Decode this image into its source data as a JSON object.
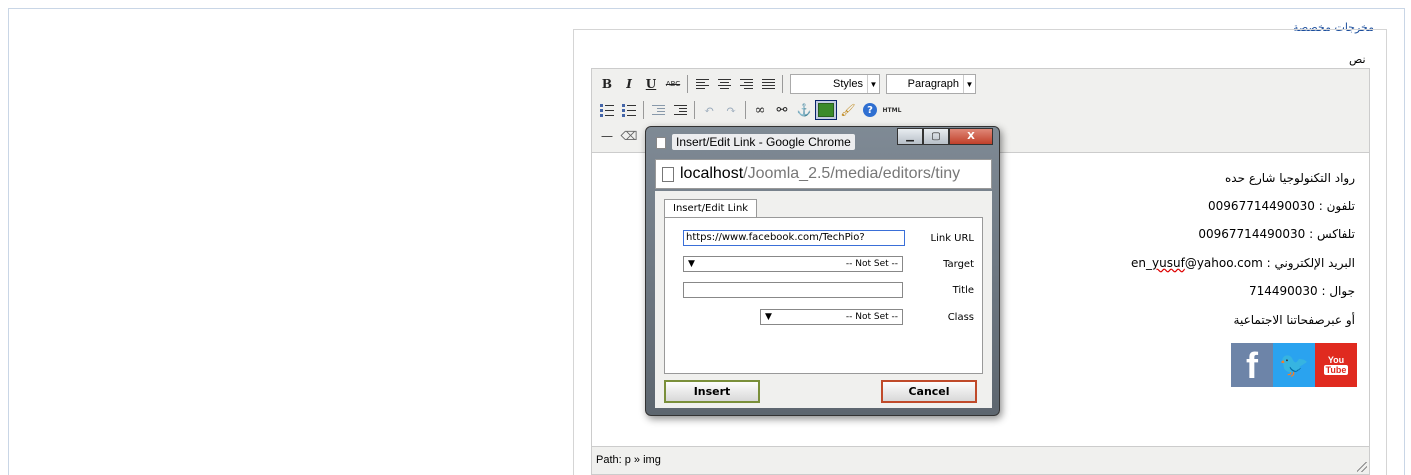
{
  "page": {
    "legend": "مخرجات مخصصة",
    "field_label": "نص"
  },
  "toolbar": {
    "bold": "B",
    "italic": "I",
    "underline": "U",
    "strikethrough": "ABC",
    "styles_label": "Styles",
    "format_label": "Paragraph",
    "html_label": "HTML",
    "help_label": "?"
  },
  "content": {
    "lines": [
      "رواد التكنولوجيا شارع حده",
      "تلفون : 00967714490030",
      "تلفاكس : 00967714490030",
      "البريد الإلكتروني : en_yusuf@yahoo.com",
      "جوال : 714490030",
      "أو عبرصفحاتنا الاجتماعية"
    ],
    "email_prefix": "البريد الإلكتروني : en_",
    "email_misspelled": "yusuf",
    "email_suffix": "@yahoo.com",
    "social": {
      "facebook_glyph": "f",
      "twitter_glyph": "🐦",
      "youtube_you": "You",
      "youtube_tube": "Tube"
    }
  },
  "statusbar": {
    "path": "Path: p » img"
  },
  "popup": {
    "window_title": "Insert/Edit Link - Google Chrome",
    "minimize": "▁",
    "maximize": "▢",
    "close": "X",
    "address_host": "localhost",
    "address_path": "/Joomla_2.5/media/editors/tiny",
    "tab_label": "Insert/Edit Link",
    "fields": {
      "url_label": "Link URL",
      "url_value": "https://www.facebook.com/TechPio?",
      "target_label": "Target",
      "target_value": "-- Not Set --",
      "title_label": "Title",
      "title_value": "",
      "class_label": "Class",
      "class_value": "-- Not Set --",
      "dropdown_arrow": "▼"
    },
    "insert_button": "Insert",
    "cancel_button": "Cancel"
  },
  "colors": {
    "legend_blue": "#1a4d9c",
    "toolbar_bg": "#f0f0ee",
    "close_red": "#c0402a",
    "facebook": "#6d84a8",
    "twitter": "#2aa3ef",
    "youtube": "#e02a1f"
  }
}
